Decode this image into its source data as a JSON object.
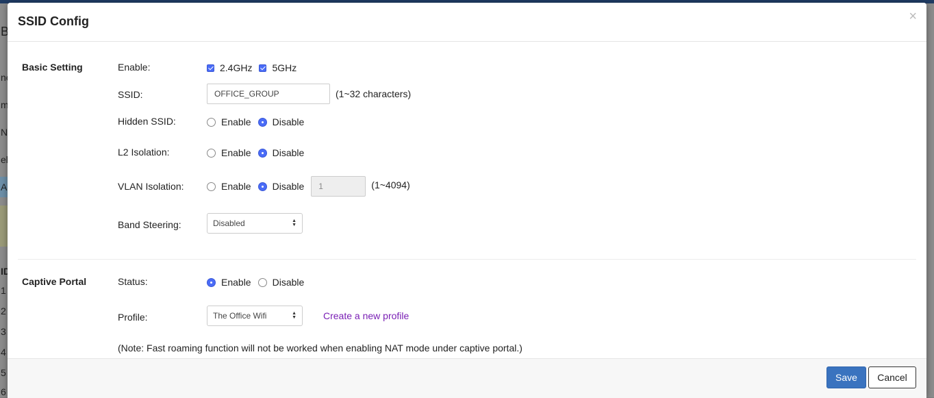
{
  "modal": {
    "title": "SSID Config",
    "close_symbol": "×"
  },
  "basic": {
    "section_label": "Basic Setting",
    "enable_label": "Enable:",
    "band_24": "2.4GHz",
    "band_5": "5GHz",
    "ssid_label": "SSID:",
    "ssid_value": "OFFICE_GROUP",
    "ssid_hint": "(1~32 characters)",
    "hidden_label": "Hidden SSID:",
    "l2_label": "L2 Isolation:",
    "vlan_label": "VLAN Isolation:",
    "vlan_value": "1",
    "vlan_hint": "(1~4094)",
    "band_steering_label": "Band Steering:",
    "band_steering_value": "Disabled",
    "enable_option": "Enable",
    "disable_option": "Disable"
  },
  "captive": {
    "section_label": "Captive Portal",
    "status_label": "Status:",
    "profile_label": "Profile:",
    "profile_value": "The Office Wifi",
    "create_link": "Create a new profile",
    "note": "(Note: Fast roaming function will not be worked when enabling NAT mode under captive portal.)",
    "enable_option": "Enable",
    "disable_option": "Disable"
  },
  "footer": {
    "save_label": "Save",
    "cancel_label": "Cancel"
  },
  "background": {
    "letters": [
      "B",
      "ne",
      "m",
      "N",
      "el",
      "Al",
      "ID",
      "1",
      "2",
      "3",
      "4",
      "5",
      "6"
    ]
  },
  "colors": {
    "accent": "#4a6cf7",
    "save_button": "#3a73bf",
    "link": "#7a1fb5"
  }
}
